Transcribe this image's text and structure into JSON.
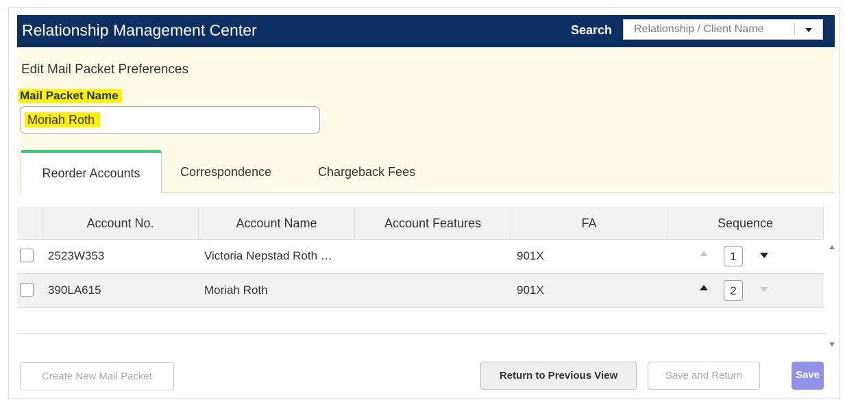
{
  "header": {
    "title": "Relationship Management Center",
    "search_label": "Search",
    "search_placeholder": "Relationship / Client Name"
  },
  "form": {
    "section_title": "Edit Mail Packet Preferences",
    "mail_packet_label": "Mail Packet Name",
    "mail_packet_value": "Moriah Roth"
  },
  "tabs": [
    {
      "label": "Reorder Accounts"
    },
    {
      "label": "Correspondence"
    },
    {
      "label": "Chargeback Fees"
    }
  ],
  "table": {
    "columns": [
      "Account No.",
      "Account Name",
      "Account Features",
      "FA",
      "Sequence"
    ],
    "rows": [
      {
        "account_no": "2523W353",
        "account_name": "Victoria Nepstad Roth …",
        "account_features": "",
        "fa": "901X",
        "sequence": "1"
      },
      {
        "account_no": "390LA615",
        "account_name": "Moriah Roth",
        "account_features": "",
        "fa": "901X",
        "sequence": "2"
      }
    ]
  },
  "buttons": {
    "create_new": "Create New Mail Packet",
    "return_previous": "Return to Previous View",
    "save_and_return": "Save and Return",
    "save": "Save"
  },
  "colors": {
    "header_bg": "#0b2f63",
    "panel_bg": "#fffbe6",
    "highlight": "#ffef00",
    "tab_accent": "#2ecc71",
    "save_button": "#8f92e6"
  }
}
